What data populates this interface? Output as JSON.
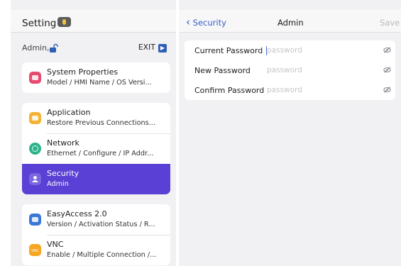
{
  "left": {
    "title": "Setting",
    "user": "Admin,",
    "exit_label": "EXIT",
    "exit_glyph": "▶",
    "groups": [
      {
        "items": [
          {
            "title": "System Properties",
            "subtitle": "Model / HMI Name / OS Versi...",
            "icon": "system-properties-icon",
            "color": "#e64a6f"
          }
        ]
      },
      {
        "items": [
          {
            "title": "Application",
            "subtitle": "Restore Previous Connections...",
            "icon": "application-icon",
            "color": "#f2b233"
          },
          {
            "title": "Network",
            "subtitle": "Ethernet / Configure / IP Addr...",
            "icon": "network-icon",
            "color": "#2bb38a"
          },
          {
            "title": "Security",
            "subtitle": "Admin",
            "icon": "security-icon",
            "color": "#7a66e0",
            "active": true
          }
        ]
      },
      {
        "items": [
          {
            "title": "EasyAccess 2.0",
            "subtitle": "Version / Activation Status / R...",
            "icon": "easyaccess-icon",
            "color": "#3a78d8"
          },
          {
            "title": "VNC",
            "subtitle": "Enable / Multiple Connection /...",
            "icon": "vnc-icon",
            "color": "#f5a623"
          }
        ]
      }
    ]
  },
  "right": {
    "back_label": "Security",
    "back_glyph": "‹",
    "title": "Admin",
    "save_label": "Save",
    "fields": [
      {
        "label": "Current Password",
        "placeholder": "password",
        "value": ""
      },
      {
        "label": "New Password",
        "placeholder": "password",
        "value": ""
      },
      {
        "label": "Confirm Password",
        "placeholder": "password",
        "value": ""
      }
    ]
  },
  "colors": {
    "accent": "#5a40d4",
    "link": "#3a5fc4"
  }
}
